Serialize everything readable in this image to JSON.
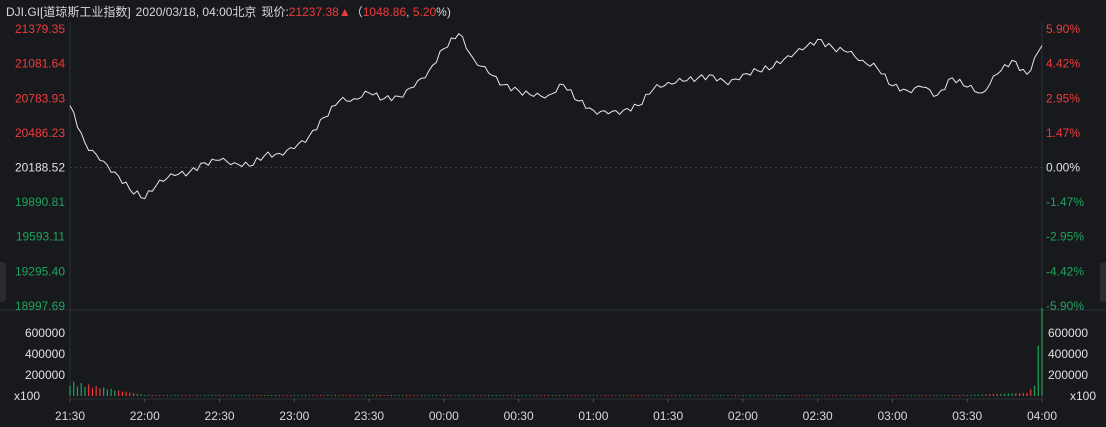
{
  "header": {
    "symbol": "DJI.GI[道琼斯工业指数]",
    "datetime": "2020/03/18, 04:00北京",
    "price_label": "现价:",
    "price": "21237.38",
    "arrow": "▲",
    "open_paren": "（",
    "change": "1048.86",
    "sep": ", ",
    "change_pct": "5.20",
    "pct_close": "%)"
  },
  "colors": {
    "background": "#17191d",
    "line": "#e8e8e8",
    "up": "#f03b3b",
    "down": "#1fa35e",
    "neutral": "#e0e0e0",
    "grid": "#2b2e33"
  },
  "chart_data": {
    "type": "line",
    "price_axis": {
      "labels": [
        "21379.35",
        "21081.64",
        "20783.93",
        "20486.23",
        "20188.52",
        "19890.81",
        "19593.11",
        "19295.40",
        "18997.69"
      ],
      "ylim": [
        18997.69,
        21379.35
      ],
      "base": 20188.52
    },
    "pct_axis": {
      "labels": [
        "5.90%",
        "4.42%",
        "2.95%",
        "1.47%",
        "0.00%",
        "-1.47%",
        "-2.95%",
        "-4.42%",
        "-5.90%"
      ]
    },
    "volume_axis": {
      "labels": [
        "600000",
        "400000",
        "200000"
      ],
      "unit": "x100",
      "ylim": [
        0,
        800000
      ]
    },
    "x_ticks": [
      "21:30",
      "22:00",
      "22:30",
      "23:00",
      "23:30",
      "00:00",
      "00:30",
      "01:00",
      "01:30",
      "02:00",
      "02:30",
      "03:00",
      "03:30",
      "04:00"
    ],
    "series": [
      {
        "x": [
          "21:30",
          "21:36",
          "21:42",
          "21:48",
          "21:54",
          "22:00",
          "22:06",
          "22:12",
          "22:18",
          "22:24",
          "22:30",
          "22:36",
          "22:42",
          "22:48",
          "22:54",
          "23:00",
          "23:06",
          "23:12",
          "23:18",
          "23:24",
          "23:30",
          "23:36",
          "23:42",
          "23:48",
          "23:54",
          "00:00",
          "00:06",
          "00:12",
          "00:18",
          "00:24",
          "00:30",
          "00:36",
          "00:42",
          "00:48",
          "00:54",
          "01:00",
          "01:06",
          "01:12",
          "01:18",
          "01:24",
          "01:30",
          "01:36",
          "01:42",
          "01:48",
          "01:54",
          "02:00",
          "02:06",
          "02:12",
          "02:18",
          "02:24",
          "02:30",
          "02:36",
          "02:42",
          "02:48",
          "02:54",
          "03:00",
          "03:06",
          "03:12",
          "03:18",
          "03:24",
          "03:30",
          "03:36",
          "03:42",
          "03:48",
          "03:54",
          "04:00"
        ],
        "y": [
          20720,
          20400,
          20250,
          20150,
          20000,
          19920,
          20080,
          20120,
          20150,
          20230,
          20250,
          20230,
          20200,
          20290,
          20310,
          20350,
          20460,
          20620,
          20760,
          20780,
          20830,
          20780,
          20800,
          20880,
          21020,
          21210,
          21340,
          21120,
          21000,
          20900,
          20850,
          20800,
          20810,
          20900,
          20760,
          20680,
          20650,
          20680,
          20720,
          20860,
          20920,
          20930,
          20960,
          20980,
          20900,
          20990,
          21020,
          21050,
          21150,
          21200,
          21290,
          21220,
          21180,
          21110,
          21040,
          20890,
          20850,
          20880,
          20810,
          20960,
          20880,
          20830,
          20990,
          21110,
          20990,
          21237
        ]
      }
    ],
    "volume": {
      "x": [
        "21:30",
        "22:00",
        "22:30",
        "23:00",
        "23:30",
        "00:00",
        "00:30",
        "01:00",
        "01:30",
        "02:00",
        "02:30",
        "03:00",
        "03:30",
        "03:54",
        "03:57",
        "04:00"
      ],
      "values": [
        120000,
        8000,
        9000,
        8500,
        9000,
        8000,
        8500,
        7500,
        7000,
        8000,
        7500,
        8000,
        9000,
        30000,
        90000,
        790000
      ]
    }
  }
}
